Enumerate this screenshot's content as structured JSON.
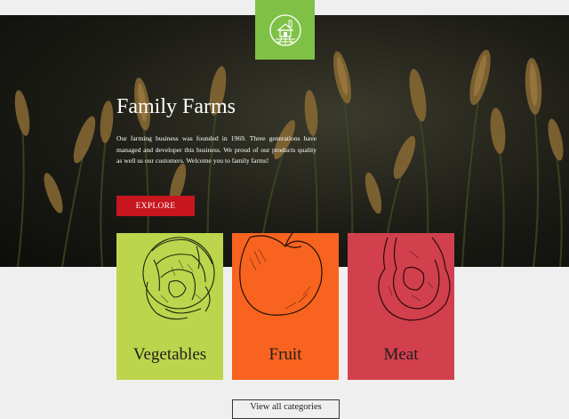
{
  "logo": {
    "icon": "farm-barn-icon",
    "color": "#7fc146"
  },
  "hero": {
    "title": "Family Farms",
    "text": "Our farming business was founded in 1969. Three generations have managed and developer this business. We proud of our products quality as well us our customers. Welcome you to family farms!",
    "explore_label": "EXPLORE",
    "explore_color": "#c8151e"
  },
  "categories": [
    {
      "label": "Vegetables",
      "icon": "cabbage-icon",
      "color": "#bcd54c"
    },
    {
      "label": "Fruit",
      "icon": "apple-icon",
      "color": "#f8631f"
    },
    {
      "label": "Meat",
      "icon": "steak-icon",
      "color": "#d2404d"
    }
  ],
  "view_all_label": "View all categories"
}
